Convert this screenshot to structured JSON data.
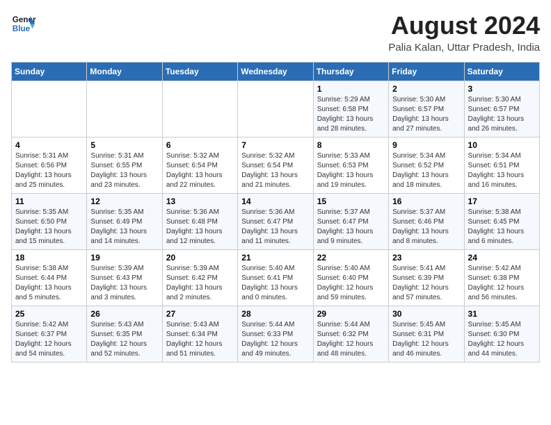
{
  "header": {
    "logo_line1": "General",
    "logo_line2": "Blue",
    "main_title": "August 2024",
    "subtitle": "Palia Kalan, Uttar Pradesh, India"
  },
  "weekdays": [
    "Sunday",
    "Monday",
    "Tuesday",
    "Wednesday",
    "Thursday",
    "Friday",
    "Saturday"
  ],
  "weeks": [
    [
      {
        "day": "",
        "info": ""
      },
      {
        "day": "",
        "info": ""
      },
      {
        "day": "",
        "info": ""
      },
      {
        "day": "",
        "info": ""
      },
      {
        "day": "1",
        "info": "Sunrise: 5:29 AM\nSunset: 6:58 PM\nDaylight: 13 hours\nand 28 minutes."
      },
      {
        "day": "2",
        "info": "Sunrise: 5:30 AM\nSunset: 6:57 PM\nDaylight: 13 hours\nand 27 minutes."
      },
      {
        "day": "3",
        "info": "Sunrise: 5:30 AM\nSunset: 6:57 PM\nDaylight: 13 hours\nand 26 minutes."
      }
    ],
    [
      {
        "day": "4",
        "info": "Sunrise: 5:31 AM\nSunset: 6:56 PM\nDaylight: 13 hours\nand 25 minutes."
      },
      {
        "day": "5",
        "info": "Sunrise: 5:31 AM\nSunset: 6:55 PM\nDaylight: 13 hours\nand 23 minutes."
      },
      {
        "day": "6",
        "info": "Sunrise: 5:32 AM\nSunset: 6:54 PM\nDaylight: 13 hours\nand 22 minutes."
      },
      {
        "day": "7",
        "info": "Sunrise: 5:32 AM\nSunset: 6:54 PM\nDaylight: 13 hours\nand 21 minutes."
      },
      {
        "day": "8",
        "info": "Sunrise: 5:33 AM\nSunset: 6:53 PM\nDaylight: 13 hours\nand 19 minutes."
      },
      {
        "day": "9",
        "info": "Sunrise: 5:34 AM\nSunset: 6:52 PM\nDaylight: 13 hours\nand 18 minutes."
      },
      {
        "day": "10",
        "info": "Sunrise: 5:34 AM\nSunset: 6:51 PM\nDaylight: 13 hours\nand 16 minutes."
      }
    ],
    [
      {
        "day": "11",
        "info": "Sunrise: 5:35 AM\nSunset: 6:50 PM\nDaylight: 13 hours\nand 15 minutes."
      },
      {
        "day": "12",
        "info": "Sunrise: 5:35 AM\nSunset: 6:49 PM\nDaylight: 13 hours\nand 14 minutes."
      },
      {
        "day": "13",
        "info": "Sunrise: 5:36 AM\nSunset: 6:48 PM\nDaylight: 13 hours\nand 12 minutes."
      },
      {
        "day": "14",
        "info": "Sunrise: 5:36 AM\nSunset: 6:47 PM\nDaylight: 13 hours\nand 11 minutes."
      },
      {
        "day": "15",
        "info": "Sunrise: 5:37 AM\nSunset: 6:47 PM\nDaylight: 13 hours\nand 9 minutes."
      },
      {
        "day": "16",
        "info": "Sunrise: 5:37 AM\nSunset: 6:46 PM\nDaylight: 13 hours\nand 8 minutes."
      },
      {
        "day": "17",
        "info": "Sunrise: 5:38 AM\nSunset: 6:45 PM\nDaylight: 13 hours\nand 6 minutes."
      }
    ],
    [
      {
        "day": "18",
        "info": "Sunrise: 5:38 AM\nSunset: 6:44 PM\nDaylight: 13 hours\nand 5 minutes."
      },
      {
        "day": "19",
        "info": "Sunrise: 5:39 AM\nSunset: 6:43 PM\nDaylight: 13 hours\nand 3 minutes."
      },
      {
        "day": "20",
        "info": "Sunrise: 5:39 AM\nSunset: 6:42 PM\nDaylight: 13 hours\nand 2 minutes."
      },
      {
        "day": "21",
        "info": "Sunrise: 5:40 AM\nSunset: 6:41 PM\nDaylight: 13 hours\nand 0 minutes."
      },
      {
        "day": "22",
        "info": "Sunrise: 5:40 AM\nSunset: 6:40 PM\nDaylight: 12 hours\nand 59 minutes."
      },
      {
        "day": "23",
        "info": "Sunrise: 5:41 AM\nSunset: 6:39 PM\nDaylight: 12 hours\nand 57 minutes."
      },
      {
        "day": "24",
        "info": "Sunrise: 5:42 AM\nSunset: 6:38 PM\nDaylight: 12 hours\nand 56 minutes."
      }
    ],
    [
      {
        "day": "25",
        "info": "Sunrise: 5:42 AM\nSunset: 6:37 PM\nDaylight: 12 hours\nand 54 minutes."
      },
      {
        "day": "26",
        "info": "Sunrise: 5:43 AM\nSunset: 6:35 PM\nDaylight: 12 hours\nand 52 minutes."
      },
      {
        "day": "27",
        "info": "Sunrise: 5:43 AM\nSunset: 6:34 PM\nDaylight: 12 hours\nand 51 minutes."
      },
      {
        "day": "28",
        "info": "Sunrise: 5:44 AM\nSunset: 6:33 PM\nDaylight: 12 hours\nand 49 minutes."
      },
      {
        "day": "29",
        "info": "Sunrise: 5:44 AM\nSunset: 6:32 PM\nDaylight: 12 hours\nand 48 minutes."
      },
      {
        "day": "30",
        "info": "Sunrise: 5:45 AM\nSunset: 6:31 PM\nDaylight: 12 hours\nand 46 minutes."
      },
      {
        "day": "31",
        "info": "Sunrise: 5:45 AM\nSunset: 6:30 PM\nDaylight: 12 hours\nand 44 minutes."
      }
    ]
  ]
}
